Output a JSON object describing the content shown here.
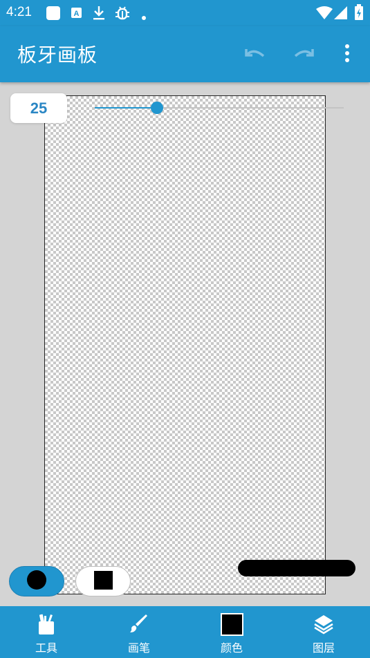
{
  "status_bar": {
    "time": "4:21",
    "icons": [
      "app-notification-icon",
      "a-box-icon",
      "download-icon",
      "bug-icon",
      "dot-icon",
      "wifi-icon",
      "signal-icon",
      "battery-charging-icon"
    ]
  },
  "app_bar": {
    "title": "板牙画板",
    "actions": [
      "undo-icon",
      "redo-icon",
      "more-vert-icon"
    ]
  },
  "brush_size": {
    "value": "25",
    "slider_fraction": 0.25
  },
  "bottom_nav": {
    "items": [
      {
        "label": "工具",
        "icon": "tools-icon"
      },
      {
        "label": "画笔",
        "icon": "brush-icon"
      },
      {
        "label": "颜色",
        "icon": "color-swatch-icon"
      },
      {
        "label": "图层",
        "icon": "layers-icon"
      }
    ]
  },
  "colors": {
    "primary": "#2196cf",
    "work_area": "#d4d4d4",
    "current_color": "#000000",
    "size_text": "#2a86c4"
  }
}
